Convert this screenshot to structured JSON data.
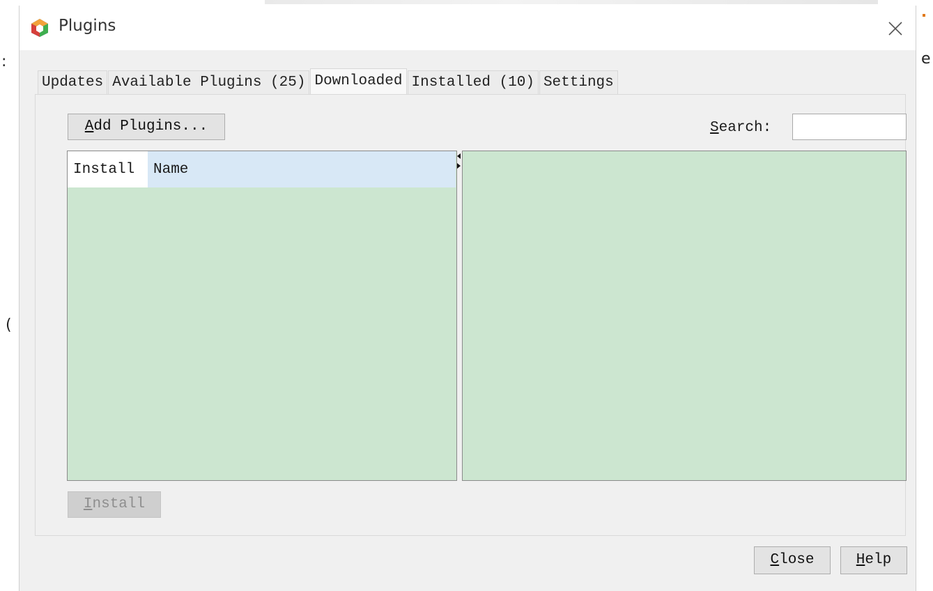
{
  "window": {
    "title": "Plugins"
  },
  "tabs": [
    {
      "label": "Updates",
      "active": false
    },
    {
      "label": "Available Plugins (25)",
      "active": false
    },
    {
      "label": "Downloaded",
      "active": true
    },
    {
      "label": "Installed (10)",
      "active": false
    },
    {
      "label": "Settings",
      "active": false
    }
  ],
  "toolbar": {
    "add_plugins_mnemonic": "A",
    "add_plugins_rest": "dd Plugins...",
    "search_mnemonic": "S",
    "search_rest": "earch:",
    "search_value": ""
  },
  "table": {
    "columns": [
      "Install",
      "Name"
    ],
    "rows": []
  },
  "actions": {
    "install_mnemonic": "I",
    "install_rest": "nstall",
    "install_enabled": false
  },
  "footer": {
    "close_mnemonic": "C",
    "close_rest": "lose",
    "help_mnemonic": "H",
    "help_rest": "elp"
  },
  "colors": {
    "pane_background": "#cce6d0",
    "header_selected": "#d8e8f6",
    "dialog_background": "#f0f0f0"
  },
  "icons": {
    "app": "netbeans-cube-icon",
    "close": "close-x-icon"
  }
}
